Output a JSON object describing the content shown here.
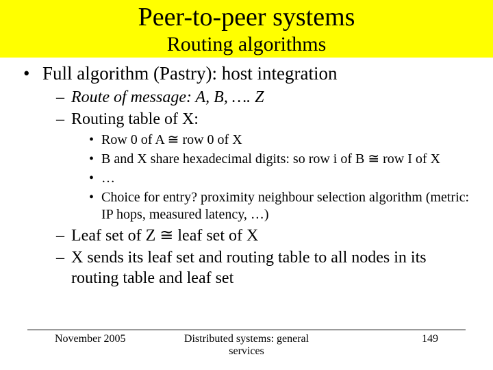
{
  "header": {
    "title": "Peer-to-peer systems",
    "subtitle": "Routing algorithms"
  },
  "main": {
    "bullet1": "Full algorithm (Pastry): host integration",
    "sub1": "Route of message: A, B, …. Z",
    "sub2": "Routing table of X:",
    "inner1": "Row 0 of A ≅ row 0 of X",
    "inner2": "B and X share hexadecimal digits: so row i of B ≅ row I of X",
    "inner3": "…",
    "inner4": "Choice for entry?  proximity neighbour selection algorithm (metric: IP hops, measured latency, …)",
    "sub3": "Leaf set of Z ≅ leaf set of X",
    "sub4": "X sends its leaf set and routing table to all nodes in its routing table and leaf set"
  },
  "footer": {
    "date": "November 2005",
    "course": "Distributed systems: general services",
    "page": "149"
  }
}
